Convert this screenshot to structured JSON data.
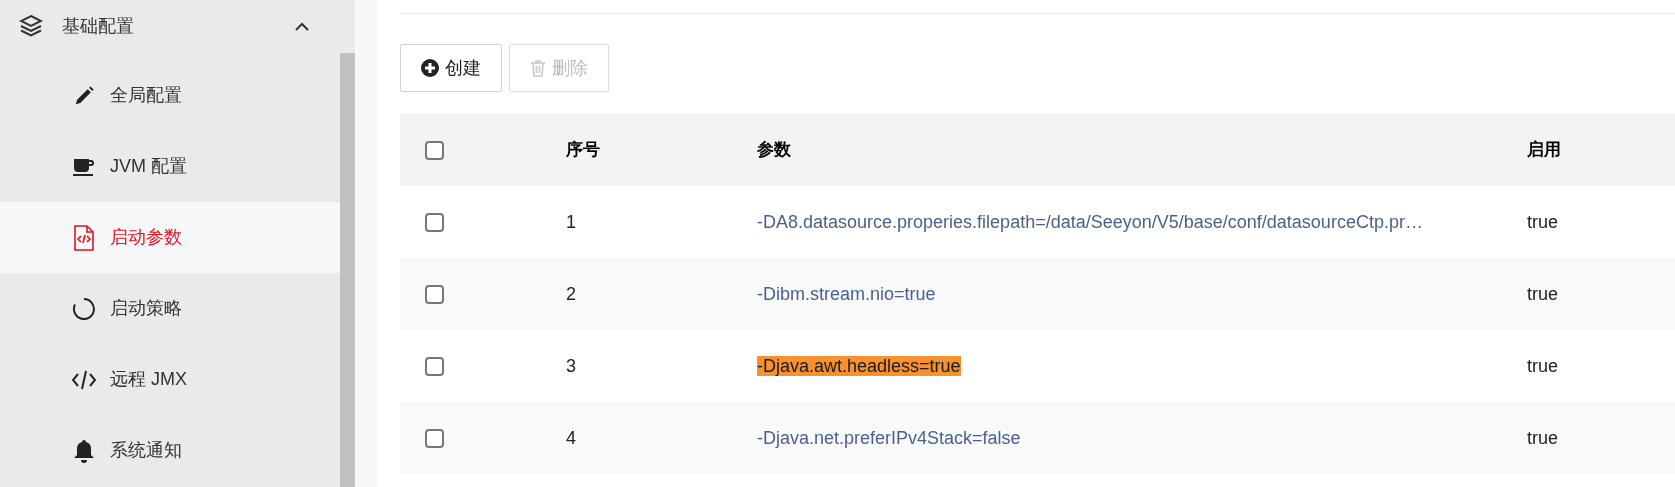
{
  "sidebar": {
    "group": {
      "label": "基础配置",
      "expanded": true
    },
    "items": [
      {
        "label": "全局配置",
        "kind": "pencil",
        "selected": false
      },
      {
        "label": "JVM 配置",
        "kind": "cup",
        "selected": false
      },
      {
        "label": "启动参数",
        "kind": "code-file",
        "selected": true
      },
      {
        "label": "启动策略",
        "kind": "spinner",
        "selected": false
      },
      {
        "label": "远程 JMX",
        "kind": "code",
        "selected": false
      },
      {
        "label": "系统通知",
        "kind": "bell",
        "selected": false
      }
    ]
  },
  "toolbar": [
    {
      "label": "创建",
      "kind": "add",
      "disabled": false
    },
    {
      "label": "删除",
      "kind": "delete",
      "disabled": true
    }
  ],
  "table": {
    "columns": [
      "序号",
      "参数",
      "启用"
    ],
    "all_checked": false,
    "rows": [
      {
        "checked": false,
        "index": "1",
        "param": "-DA8.datasource.properies.filepath=/data/Seeyon/V5/base/conf/datasourceCtp.pr…",
        "highlighted": false,
        "enabled": "true"
      },
      {
        "checked": false,
        "index": "2",
        "param": "-Dibm.stream.nio=true",
        "highlighted": false,
        "enabled": "true"
      },
      {
        "checked": false,
        "index": "3",
        "param": "-Djava.awt.headless=true",
        "highlighted": true,
        "enabled": "true"
      },
      {
        "checked": false,
        "index": "4",
        "param": "-Djava.net.preferIPv4Stack=false",
        "highlighted": false,
        "enabled": "true"
      }
    ]
  }
}
